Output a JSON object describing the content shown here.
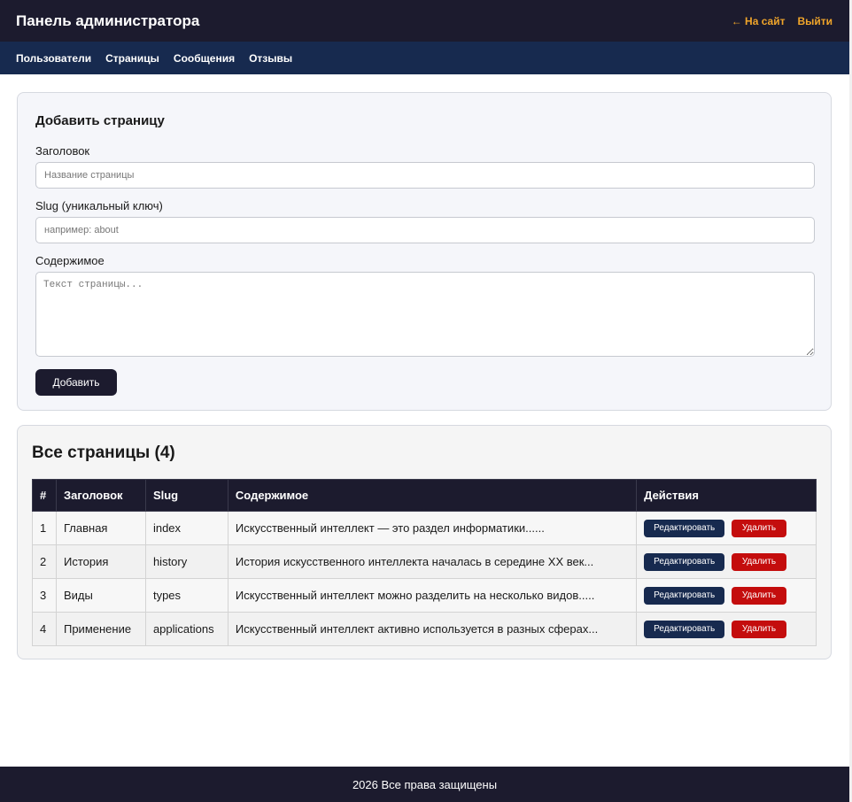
{
  "header": {
    "title": "Панель администратора",
    "to_site": "← На сайт",
    "logout": "Выйти"
  },
  "nav": {
    "items": [
      "Пользователи",
      "Страницы",
      "Сообщения",
      "Отзывы"
    ]
  },
  "form": {
    "title": "Добавить страницу",
    "title_label": "Заголовок",
    "title_placeholder": "Название страницы",
    "slug_label": "Slug (уникальный ключ)",
    "slug_placeholder": "например: about",
    "content_label": "Содержимое",
    "content_placeholder": "Текст страницы...",
    "submit": "Добавить"
  },
  "list": {
    "title": "Все страницы (4)",
    "columns": [
      "#",
      "Заголовок",
      "Slug",
      "Содержимое",
      "Действия"
    ],
    "rows": [
      {
        "num": "1",
        "title": "Главная",
        "slug": "index",
        "content": "Искусственный интеллект — это раздел информатики......"
      },
      {
        "num": "2",
        "title": "История",
        "slug": "history",
        "content": "История искусственного интеллекта началась в середине XX век..."
      },
      {
        "num": "3",
        "title": "Виды",
        "slug": "types",
        "content": "Искусственный интеллект можно разделить на несколько видов....."
      },
      {
        "num": "4",
        "title": "Применение",
        "slug": "applications",
        "content": "Искусственный интеллект активно используется в разных сферах..."
      }
    ],
    "edit_label": "Редактировать",
    "delete_label": "Удалить"
  },
  "footer": {
    "text": "2026 Все права защищены"
  },
  "colors": {
    "dark": "#1c1b2e",
    "navy": "#172a4f",
    "accent": "#f0a52a",
    "danger": "#c40d0d"
  }
}
